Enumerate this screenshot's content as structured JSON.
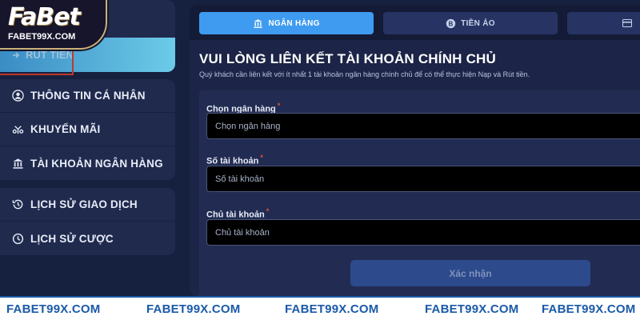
{
  "logo": {
    "brand": "FaBet",
    "domain": "FABET99X.COM"
  },
  "sidebar": {
    "active_item": {
      "label": "RÚT TIỀN"
    },
    "group1": [
      {
        "label": "THÔNG TIN CÁ NHÂN",
        "icon": "user-icon"
      },
      {
        "label": "KHUYẾN MÃI",
        "icon": "gift-icon"
      },
      {
        "label": "TÀI KHOẢN NGÂN HÀNG",
        "icon": "bank-icon"
      }
    ],
    "group2": [
      {
        "label": "LỊCH SỬ GIAO DỊCH",
        "icon": "history-icon"
      },
      {
        "label": "LỊCH SỬ CƯỢC",
        "icon": "clock-icon"
      }
    ]
  },
  "tabs": [
    {
      "label": "NGÂN HÀNG",
      "icon": "bank-icon",
      "active": true
    },
    {
      "label": "TIỀN ẢO",
      "icon": "coin-icon",
      "active": false
    },
    {
      "label": "",
      "icon": "card-icon",
      "active": false
    }
  ],
  "form": {
    "title": "VUI LÒNG LIÊN KẾT TÀI KHOẢN CHÍNH CHỦ",
    "subtitle": "Quý khách cần liên kết với ít nhất 1 tài khoản ngân hàng chính chủ để có thể thực hiện Nạp và Rút tiền.",
    "fields": [
      {
        "label": "Chọn ngân hàng",
        "required_mark": "*",
        "placeholder": "Chọn ngân hàng"
      },
      {
        "label": "Số tài khoản",
        "required_mark": "*",
        "placeholder": "Số tài khoản"
      },
      {
        "label": "Chủ tài khoản",
        "required_mark": "*",
        "placeholder": "Chủ tài khoản"
      }
    ],
    "submit_label": "Xác nhận"
  },
  "footer": {
    "watermarks": [
      "FABET99X.COM",
      "FABET99X.COM",
      "FABET99X.COM",
      "FABET99X.COM",
      "FABET99X.COM"
    ]
  },
  "colors": {
    "background": "#16203f",
    "panel": "#1c2547",
    "active_tab": "#3f9bf0",
    "required": "#e74c3c",
    "watermark": "#1a5aa8"
  }
}
